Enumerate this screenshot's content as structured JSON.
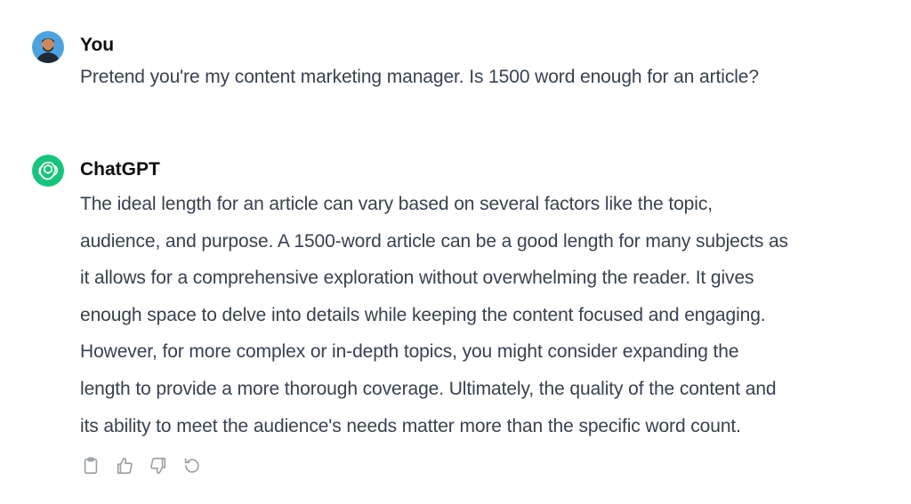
{
  "user_message": {
    "author": "You",
    "text": "Pretend you're my content marketing manager. Is 1500 word enough for an article?",
    "avatar_icon": "user-avatar-icon"
  },
  "assistant_message": {
    "author": "ChatGPT",
    "avatar_icon": "chatgpt-logo-icon",
    "avatar_color": "#19c37d",
    "lines": [
      "The ideal length for an article can vary based on several factors like the topic,",
      "audience, and purpose. A 1500-word article can be a good length for many subjects as",
      "it allows for a comprehensive exploration without overwhelming the reader. It gives",
      "enough space to delve into details while keeping the content focused and engaging.",
      "However, for more complex or in-depth topics, you might consider expanding the",
      "length to provide a more thorough coverage. Ultimately, the quality of the content and",
      "its ability to meet the audience's needs matter more than the specific word count."
    ]
  },
  "actions": [
    {
      "icon": "clipboard-icon"
    },
    {
      "icon": "thumbs-up-icon"
    },
    {
      "icon": "thumbs-down-icon"
    },
    {
      "icon": "regenerate-icon"
    }
  ]
}
